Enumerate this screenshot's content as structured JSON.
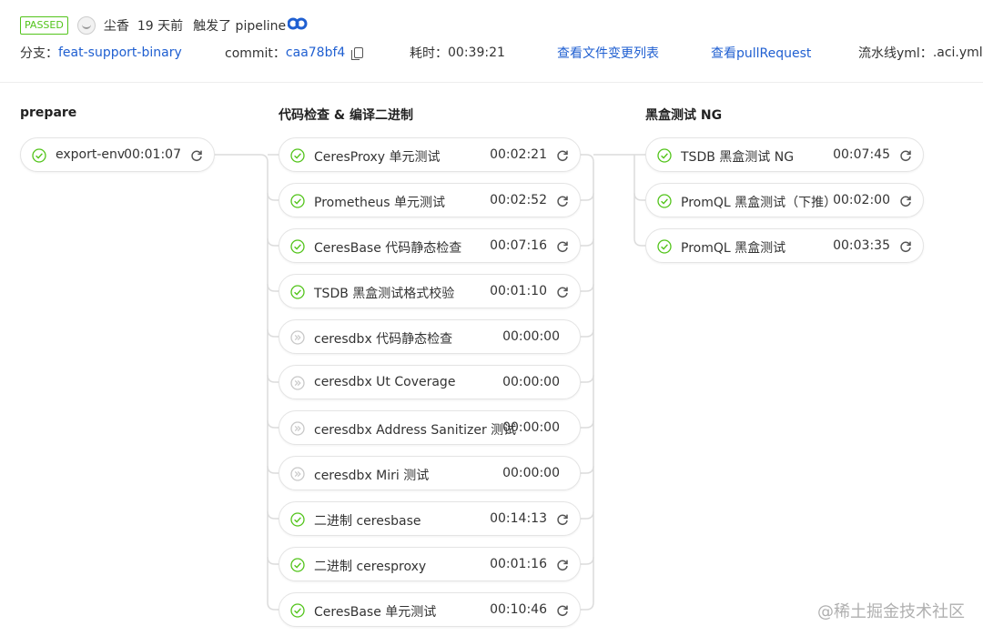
{
  "header": {
    "status": "PASSED",
    "user": "尘香",
    "time_ago": "19 天前",
    "triggered": "触发了 pipeline",
    "branch_label": "分支：",
    "branch": "feat-support-binary",
    "commit_label": "commit：",
    "commit": "caa78bf4",
    "duration_label": "耗时：",
    "duration": "00:39:21",
    "view_changes": "查看文件变更列表",
    "view_pr": "查看pullRequest",
    "yml_label": "流水线yml：",
    "yml": ".aci.yml"
  },
  "stages": [
    {
      "title": "prepare",
      "jobs": [
        {
          "name": "export-env",
          "time": "00:01:07",
          "status": "success"
        }
      ]
    },
    {
      "title": "代码检查 & 编译二进制",
      "jobs": [
        {
          "name": "CeresProxy 单元测试",
          "time": "00:02:21",
          "status": "success"
        },
        {
          "name": "Prometheus 单元测试",
          "time": "00:02:52",
          "status": "success"
        },
        {
          "name": "CeresBase 代码静态检查",
          "time": "00:07:16",
          "status": "success"
        },
        {
          "name": "TSDB 黑盒测试格式校验",
          "time": "00:01:10",
          "status": "success"
        },
        {
          "name": "ceresdbx 代码静态检查",
          "time": "00:00:00",
          "status": "skipped"
        },
        {
          "name": "ceresdbx Ut Coverage",
          "time": "00:00:00",
          "status": "skipped"
        },
        {
          "name": "ceresdbx Address Sanitizer 测试",
          "time": "00:00:00",
          "status": "skipped"
        },
        {
          "name": "ceresdbx Miri 测试",
          "time": "00:00:00",
          "status": "skipped"
        },
        {
          "name": "二进制 ceresbase",
          "time": "00:14:13",
          "status": "success"
        },
        {
          "name": "二进制 ceresproxy",
          "time": "00:01:16",
          "status": "success"
        },
        {
          "name": "CeresBase 单元测试",
          "time": "00:10:46",
          "status": "success"
        }
      ]
    },
    {
      "title": "黑盒测试 NG",
      "jobs": [
        {
          "name": "TSDB 黑盒测试 NG",
          "time": "00:07:45",
          "status": "success"
        },
        {
          "name": "PromQL 黑盒测试（下推）",
          "time": "00:02:00",
          "status": "success"
        },
        {
          "name": "PromQL 黑盒测试",
          "time": "00:03:35",
          "status": "success"
        }
      ]
    }
  ],
  "watermark": "@稀土掘金技术社区",
  "colors": {
    "success": "#52c41a",
    "skipped": "#c8c8c8",
    "link": "#1f5fd1"
  }
}
